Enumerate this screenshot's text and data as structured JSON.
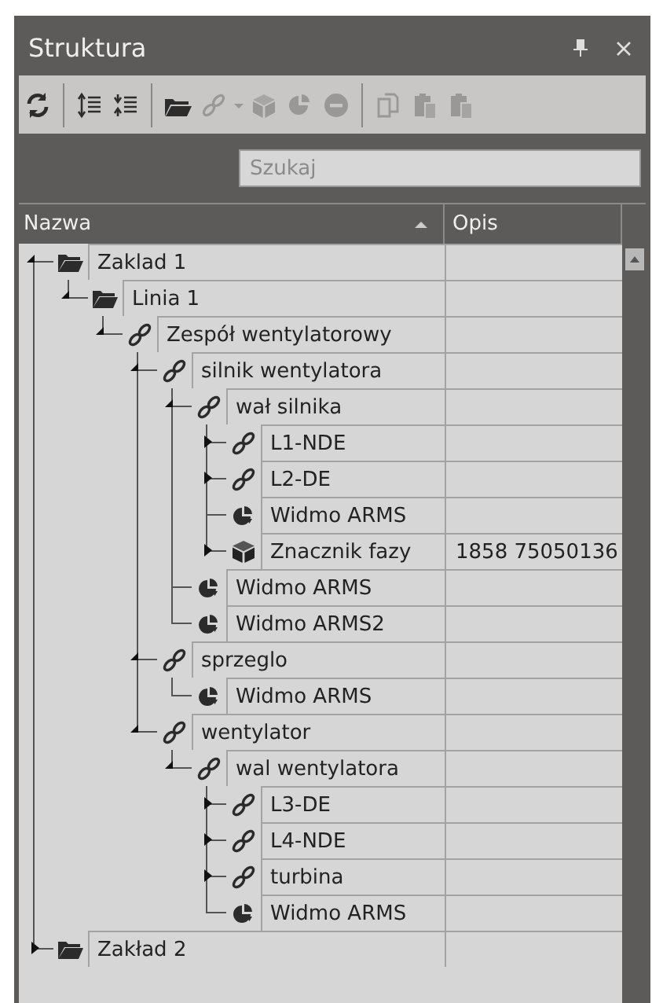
{
  "panel": {
    "title": "Struktura"
  },
  "toolbar": [
    {
      "kind": "refresh",
      "disabled": false
    },
    {
      "kind": "separator"
    },
    {
      "kind": "expand-all",
      "disabled": false
    },
    {
      "kind": "collapse-all",
      "disabled": false
    },
    {
      "kind": "separator"
    },
    {
      "kind": "folder",
      "disabled": false
    },
    {
      "kind": "link",
      "disabled": true
    },
    {
      "kind": "caret",
      "disabled": true
    },
    {
      "kind": "cube",
      "disabled": true
    },
    {
      "kind": "spectrum",
      "disabled": true
    },
    {
      "kind": "remove",
      "disabled": true
    },
    {
      "kind": "separator"
    },
    {
      "kind": "copy",
      "disabled": true
    },
    {
      "kind": "paste",
      "disabled": true
    },
    {
      "kind": "paste",
      "disabled": true
    }
  ],
  "search": {
    "placeholder": "Szukaj"
  },
  "columns": [
    {
      "label": "Nazwa",
      "sorted": true
    },
    {
      "label": "Opis",
      "sorted": false
    }
  ],
  "tree": [
    {
      "kind": "folder",
      "name": "Zaklad 1",
      "expanded": true,
      "children": [
        {
          "kind": "folder",
          "name": "Linia 1",
          "expanded": true,
          "children": [
            {
              "kind": "link",
              "name": "Zespół wentylatorowy",
              "expanded": true,
              "children": [
                {
                  "kind": "link",
                  "name": "silnik wentylatora",
                  "expanded": true,
                  "children": [
                    {
                      "kind": "link",
                      "name": "wał silnika",
                      "expanded": true,
                      "children": [
                        {
                          "kind": "link",
                          "name": "L1-NDE",
                          "expanded": false
                        },
                        {
                          "kind": "link",
                          "name": "L2-DE",
                          "expanded": false
                        },
                        {
                          "kind": "spectrum",
                          "name": "Widmo ARMS"
                        },
                        {
                          "kind": "cube",
                          "name": "Znacznik fazy",
                          "opis": "1858 75050136",
                          "expanded": false
                        }
                      ]
                    },
                    {
                      "kind": "spectrum",
                      "name": "Widmo ARMS"
                    },
                    {
                      "kind": "spectrum",
                      "name": "Widmo ARMS2"
                    }
                  ]
                },
                {
                  "kind": "link",
                  "name": "sprzeglo",
                  "expanded": true,
                  "children": [
                    {
                      "kind": "spectrum",
                      "name": "Widmo ARMS"
                    }
                  ]
                },
                {
                  "kind": "link",
                  "name": "wentylator",
                  "expanded": true,
                  "children": [
                    {
                      "kind": "link",
                      "name": "wal wentylatora",
                      "expanded": true,
                      "children": [
                        {
                          "kind": "link",
                          "name": "L3-DE",
                          "expanded": false
                        },
                        {
                          "kind": "link",
                          "name": "L4-NDE",
                          "expanded": false
                        },
                        {
                          "kind": "link",
                          "name": "turbina",
                          "expanded": false
                        },
                        {
                          "kind": "spectrum",
                          "name": "Widmo ARMS"
                        }
                      ]
                    }
                  ]
                }
              ]
            }
          ]
        }
      ]
    },
    {
      "kind": "folder",
      "name": "Zakład 2",
      "expanded": false
    }
  ]
}
